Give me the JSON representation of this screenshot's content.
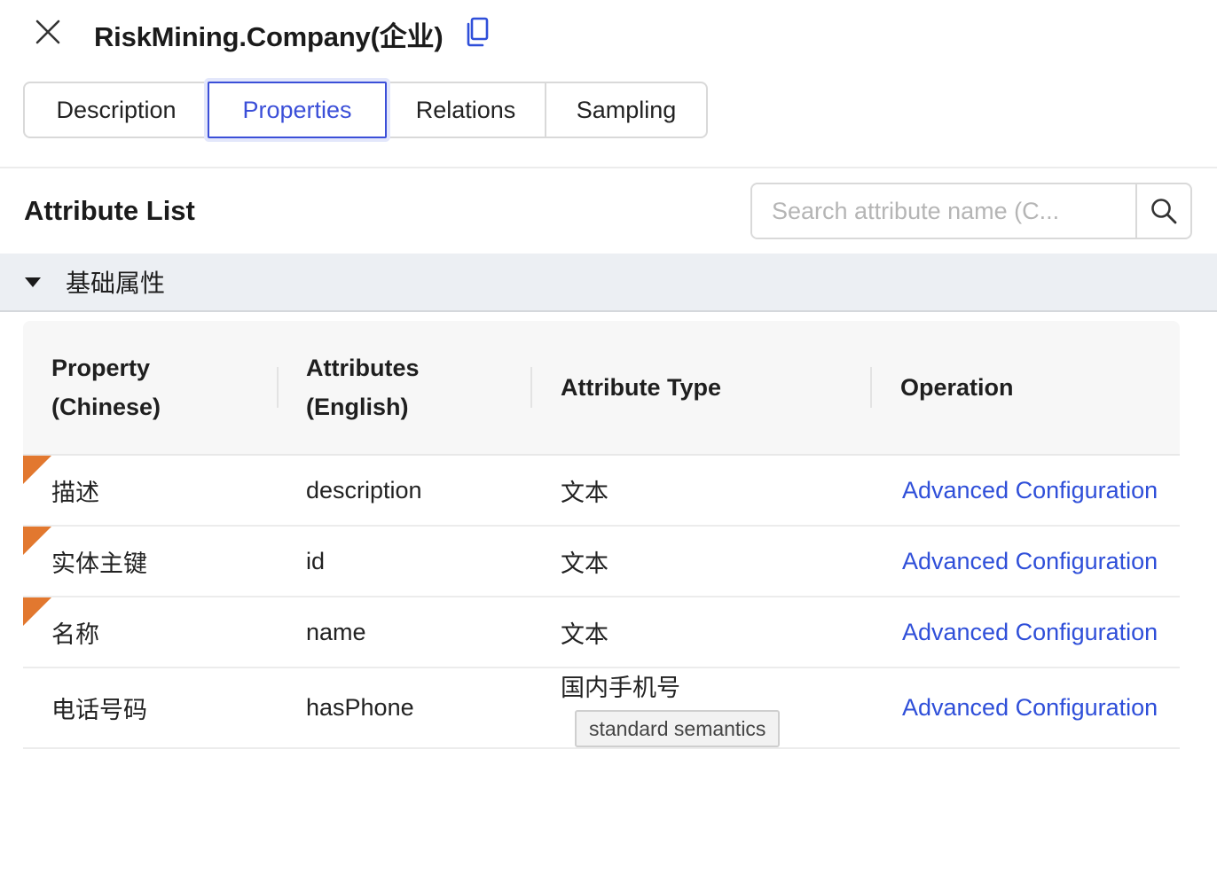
{
  "header": {
    "title": "RiskMining.Company(企业)",
    "close_icon": "close-icon",
    "copy_icon": "copy-icon"
  },
  "tabs": [
    {
      "label": "Description",
      "active": false
    },
    {
      "label": "Properties",
      "active": true
    },
    {
      "label": "Relations",
      "active": false
    },
    {
      "label": "Sampling",
      "active": false
    }
  ],
  "section": {
    "title": "Attribute List",
    "search_placeholder": "Search attribute name (C..."
  },
  "group": {
    "label": "基础属性",
    "expanded": true
  },
  "table": {
    "columns": [
      {
        "line1": "Property",
        "line2": "(Chinese)"
      },
      {
        "line1": "Attributes",
        "line2": "(English)"
      },
      {
        "line1": "Attribute Type"
      },
      {
        "line1": "Operation"
      }
    ],
    "rows": [
      {
        "chinese": "描述",
        "english": "description",
        "type": "文本",
        "operation": "Advanced Configuration",
        "flagged": true
      },
      {
        "chinese": "实体主键",
        "english": "id",
        "type": "文本",
        "operation": "Advanced Configuration",
        "flagged": true
      },
      {
        "chinese": "名称",
        "english": "name",
        "type": "文本",
        "operation": "Advanced Configuration",
        "flagged": true
      },
      {
        "chinese": "电话号码",
        "english": "hasPhone",
        "type": "国内手机号",
        "badge": "standard semantics",
        "operation": "Advanced Configuration",
        "flagged": false
      }
    ]
  },
  "colors": {
    "accent": "#3b4fd8",
    "link": "#2f4fd9",
    "flag": "#e2782f",
    "group_bg": "#eceff3"
  }
}
